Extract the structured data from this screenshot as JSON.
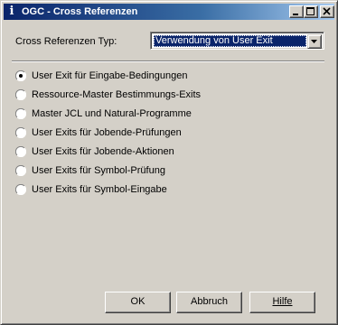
{
  "window": {
    "title": "OGC - Cross Referenzen",
    "icon": "info-icon",
    "icon_glyph": "i"
  },
  "form": {
    "type_label": "Cross Referenzen Typ:",
    "type_value": "Verwendung von User Exit"
  },
  "options": [
    {
      "label": "User Exit für Eingabe-Bedingungen",
      "selected": true
    },
    {
      "label": "Ressource-Master Bestimmungs-Exits",
      "selected": false
    },
    {
      "label": "Master JCL und Natural-Programme",
      "selected": false
    },
    {
      "label": "User Exits für Jobende-Prüfungen",
      "selected": false
    },
    {
      "label": "User Exits für Jobende-Aktionen",
      "selected": false
    },
    {
      "label": "User Exits für Symbol-Prüfung",
      "selected": false
    },
    {
      "label": "User Exits für Symbol-Eingabe",
      "selected": false
    }
  ],
  "buttons": {
    "ok": "OK",
    "cancel": "Abbruch",
    "help": "Hilfe"
  },
  "colors": {
    "titlebar_start": "#0a246a",
    "titlebar_end": "#a6caf0",
    "face": "#d4d0c8",
    "selection": "#0a246a"
  }
}
